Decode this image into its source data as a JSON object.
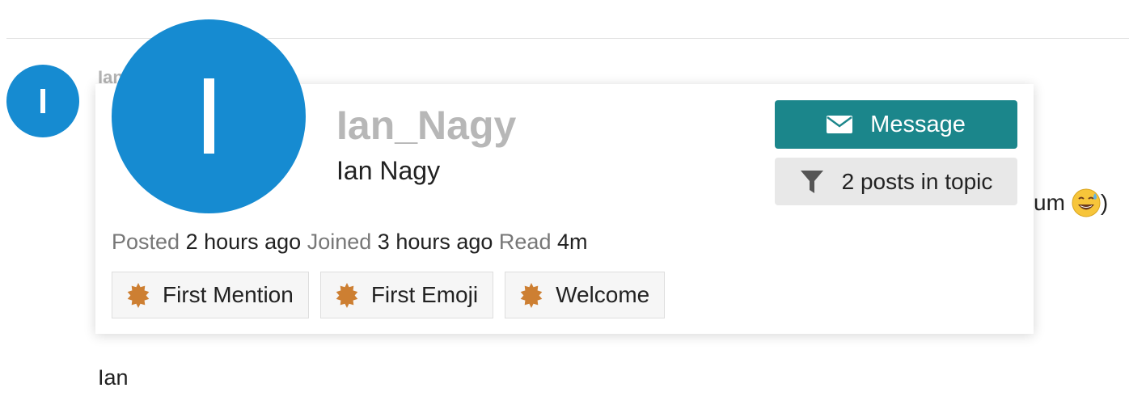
{
  "post": {
    "username_partial": "Ian",
    "avatar_letter": "I",
    "text_fragment": "um",
    "text_tail": ")",
    "signoff": "Ian"
  },
  "user_card": {
    "avatar_letter": "I",
    "username": "Ian_Nagy",
    "full_name": "Ian Nagy",
    "message_button": "Message",
    "filter_button": "2 posts in topic",
    "meta": {
      "posted_label": "Posted",
      "posted_value": "2 hours ago",
      "joined_label": "Joined",
      "joined_value": "3 hours ago",
      "read_label": "Read",
      "read_value": "4m"
    },
    "badges": [
      {
        "label": "First Mention",
        "icon": "badge-burst-icon"
      },
      {
        "label": "First Emoji",
        "icon": "badge-burst-icon"
      },
      {
        "label": "Welcome",
        "icon": "badge-burst-icon"
      }
    ]
  },
  "colors": {
    "avatar_blue": "#168bd1",
    "primary_button": "#1b868b",
    "secondary_button": "#e8e8e8",
    "badge_bronze": "#cd7f32"
  }
}
